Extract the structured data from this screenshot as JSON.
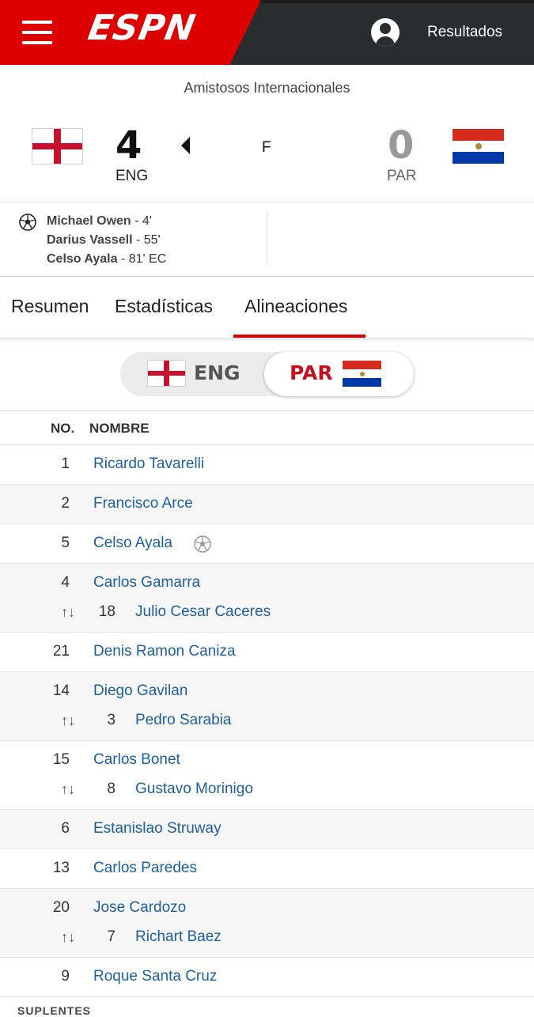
{
  "header": {
    "logo": "ESPN",
    "results_label": "Resultados",
    "icons": [
      "menu-icon",
      "account-icon"
    ]
  },
  "match": {
    "competition": "Amistosos Internacionales",
    "home": {
      "abbr": "ENG",
      "score": "4"
    },
    "away": {
      "abbr": "PAR",
      "score": "0"
    },
    "status": "F",
    "scorers": [
      {
        "name": "Michael Owen",
        "minute": " - 4'"
      },
      {
        "name": "Darius Vassell",
        "minute": " - 55'"
      },
      {
        "name": "Celso Ayala",
        "minute": " - 81' EC"
      }
    ]
  },
  "tabs": [
    "Resumen",
    "Estadísticas",
    "Alineaciones"
  ],
  "active_tab": "Alineaciones",
  "team_toggle": {
    "left": "ENG",
    "right": "PAR",
    "selected": "PAR"
  },
  "lineup": {
    "headers": {
      "number": "NO.",
      "name": "NOMBRE"
    },
    "players": [
      {
        "number": "1",
        "name": "Ricardo Tavarelli"
      },
      {
        "number": "2",
        "name": "Francisco Arce"
      },
      {
        "number": "5",
        "name": "Celso Ayala",
        "goal": true
      },
      {
        "number": "4",
        "name": "Carlos Gamarra",
        "sub": {
          "number": "18",
          "name": "Julio Cesar Caceres"
        }
      },
      {
        "number": "21",
        "name": "Denis Ramon Caniza"
      },
      {
        "number": "14",
        "name": "Diego Gavilan",
        "sub": {
          "number": "3",
          "name": "Pedro Sarabia"
        }
      },
      {
        "number": "15",
        "name": "Carlos Bonet",
        "sub": {
          "number": "8",
          "name": "Gustavo Morinigo"
        }
      },
      {
        "number": "6",
        "name": "Estanislao Struway"
      },
      {
        "number": "13",
        "name": "Carlos Paredes"
      },
      {
        "number": "20",
        "name": "Jose Cardozo",
        "sub": {
          "number": "7",
          "name": "Richart Baez"
        }
      },
      {
        "number": "9",
        "name": "Roque Santa Cruz"
      }
    ],
    "sub_icon": "↑↓",
    "next_section": "SUPLENTES"
  },
  "colors": {
    "brand_red": "#dd0000",
    "link_blue": "#1e5f9a",
    "topbar": "#2b2c2d"
  }
}
